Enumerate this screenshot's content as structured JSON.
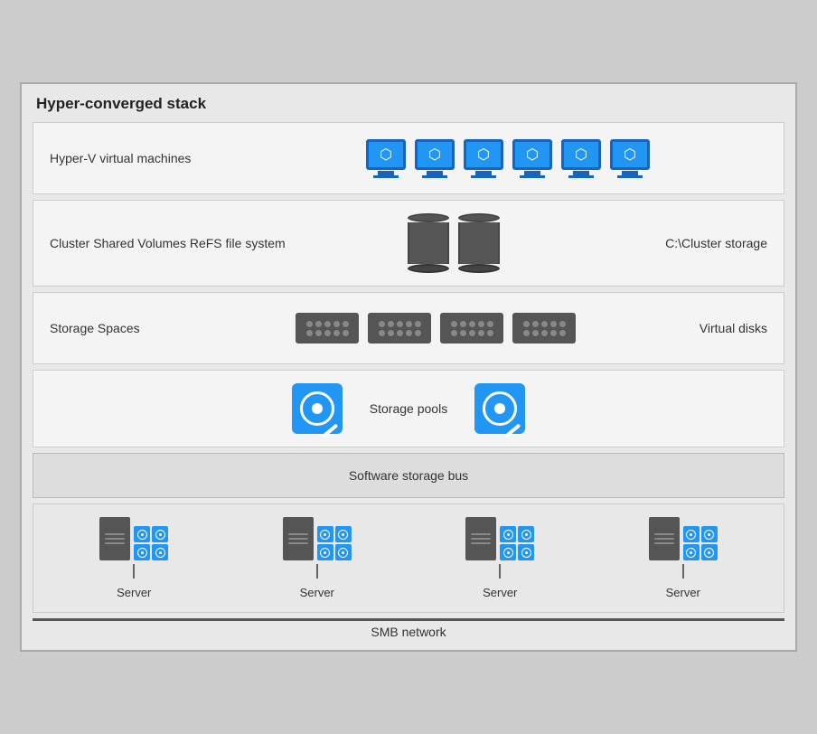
{
  "title": "Hyper-converged stack",
  "rows": [
    {
      "id": "vm-row",
      "label": "Hyper-V virtual machines",
      "label_right": "",
      "icon_count": 6,
      "icon_type": "monitor"
    },
    {
      "id": "csv-row",
      "label": "Cluster Shared Volumes ReFS file system",
      "label_right": "C:\\Cluster storage",
      "icon_count": 2,
      "icon_type": "database"
    },
    {
      "id": "ss-row",
      "label": "Storage Spaces",
      "label_right": "Virtual disks",
      "icon_count": 4,
      "icon_type": "disk-array"
    },
    {
      "id": "sp-row",
      "label": "Storage pools",
      "icon_count": 2,
      "icon_type": "hdd"
    }
  ],
  "bus_label": "Software storage bus",
  "servers": [
    "Server",
    "Server",
    "Server",
    "Server"
  ],
  "smb_label": "SMB network"
}
